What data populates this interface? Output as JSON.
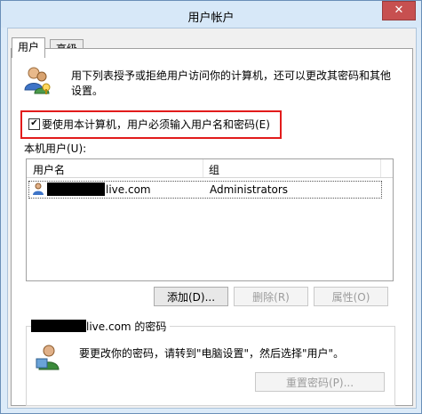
{
  "window": {
    "title": "用户帐户",
    "close_label": "✕"
  },
  "tabs": [
    {
      "label": "用户"
    },
    {
      "label": "高级"
    }
  ],
  "description": "用下列表授予或拒绝用户访问你的计算机，还可以更改其密码和其他设置。",
  "require_login": {
    "label": "要使用本计算机，用户必须输入用户名和密码(E)",
    "checked": true
  },
  "local_users_label": "本机用户(U):",
  "table": {
    "headers": [
      "用户名",
      "组"
    ],
    "rows": [
      {
        "username_suffix": "live.com",
        "group": "Administrators"
      }
    ]
  },
  "buttons": {
    "add": "添加(D)...",
    "remove": "删除(R)",
    "properties": "属性(O)",
    "reset_password": "重置密码(P)..."
  },
  "password_group": {
    "title_suffix": "live.com 的密码",
    "text": "要更改你的密码，请转到\"电脑设置\"，然后选择\"用户\"。"
  },
  "icons": {
    "users": "users-icon",
    "user_row": "user-icon",
    "user_password": "user-icon"
  }
}
